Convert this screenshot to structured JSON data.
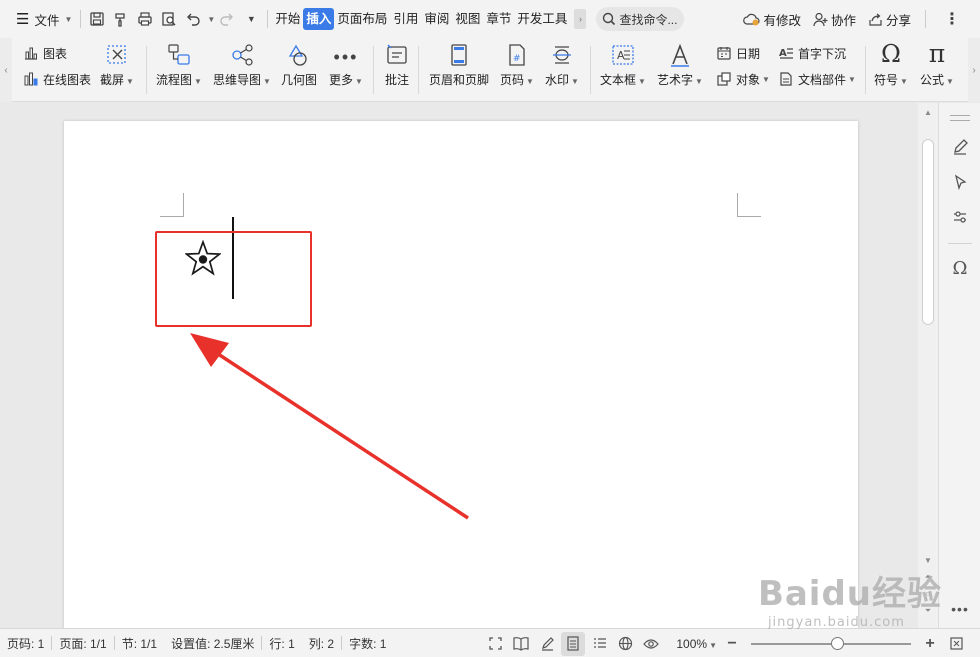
{
  "titlebar": {
    "menu_label": "文件",
    "tabs": [
      "开始",
      "插入",
      "页面布局",
      "引用",
      "审阅",
      "视图",
      "章节",
      "开发工具"
    ],
    "active_tab": "插入",
    "search_label": "查找命令...",
    "modified_label": "有修改",
    "collab_label": "协作",
    "share_label": "分享"
  },
  "ribbon": {
    "chart_label": "图表",
    "online_chart_label": "在线图表",
    "screenshot_label": "截屏",
    "flowchart_label": "流程图",
    "mindmap_label": "思维导图",
    "geometry_label": "几何图",
    "more_label": "更多",
    "comment_label": "批注",
    "header_footer_label": "页眉和页脚",
    "page_number_label": "页码",
    "watermark_label": "水印",
    "textbox_label": "文本框",
    "wordart_label": "艺术字",
    "date_label": "日期",
    "object_label": "对象",
    "dropcap_label": "首字下沉",
    "docparts_label": "文档部件",
    "symbol_label": "符号",
    "formula_label": "公式"
  },
  "statusbar": {
    "page_no": "页码: 1",
    "pages": "页面: 1/1",
    "section": "节: 1/1",
    "setting": "设置值: 2.5厘米",
    "row": "行: 1",
    "col": "列: 2",
    "words": "字数: 1",
    "zoom": "100%",
    "zoom_fraction": 0.54
  },
  "watermark": {
    "main": "Baidu经验",
    "sub": "jingyan.baidu.com"
  },
  "colors": {
    "accent": "#3a7be8",
    "highlight": "#e8312a"
  }
}
